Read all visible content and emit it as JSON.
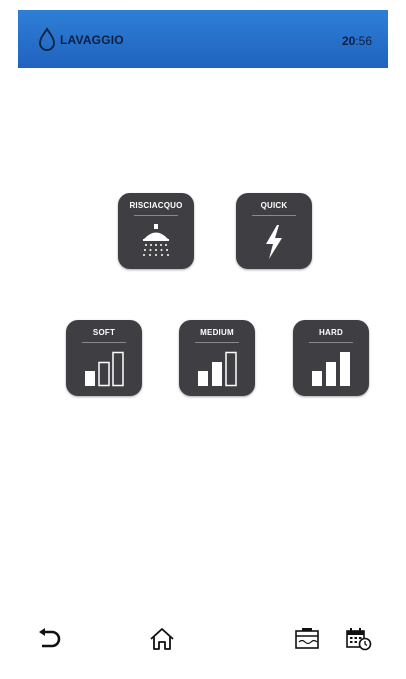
{
  "header": {
    "title": "LAVAGGIO",
    "time_hours": "20",
    "time_separator": ":",
    "time_minutes": "56",
    "icon": "water-drop-icon"
  },
  "tiles": [
    {
      "label": "RISCIACQUO",
      "icon": "shower-icon"
    },
    {
      "label": "QUICK",
      "icon": "lightning-icon"
    },
    {
      "label": "SOFT",
      "icon": "level-bars-icon"
    },
    {
      "label": "MEDIUM",
      "icon": "level-bars-icon"
    },
    {
      "label": "HARD",
      "icon": "level-bars-icon"
    }
  ],
  "nav": {
    "back": "back-icon",
    "home": "home-icon",
    "tank": "tank-icon",
    "schedule": "calendar-clock-icon"
  },
  "colors": {
    "header_top": "#2f7fd6",
    "header_bottom": "#1f63bf",
    "tile_background": "#3f3f43",
    "bar_fill": "#ffffff"
  }
}
